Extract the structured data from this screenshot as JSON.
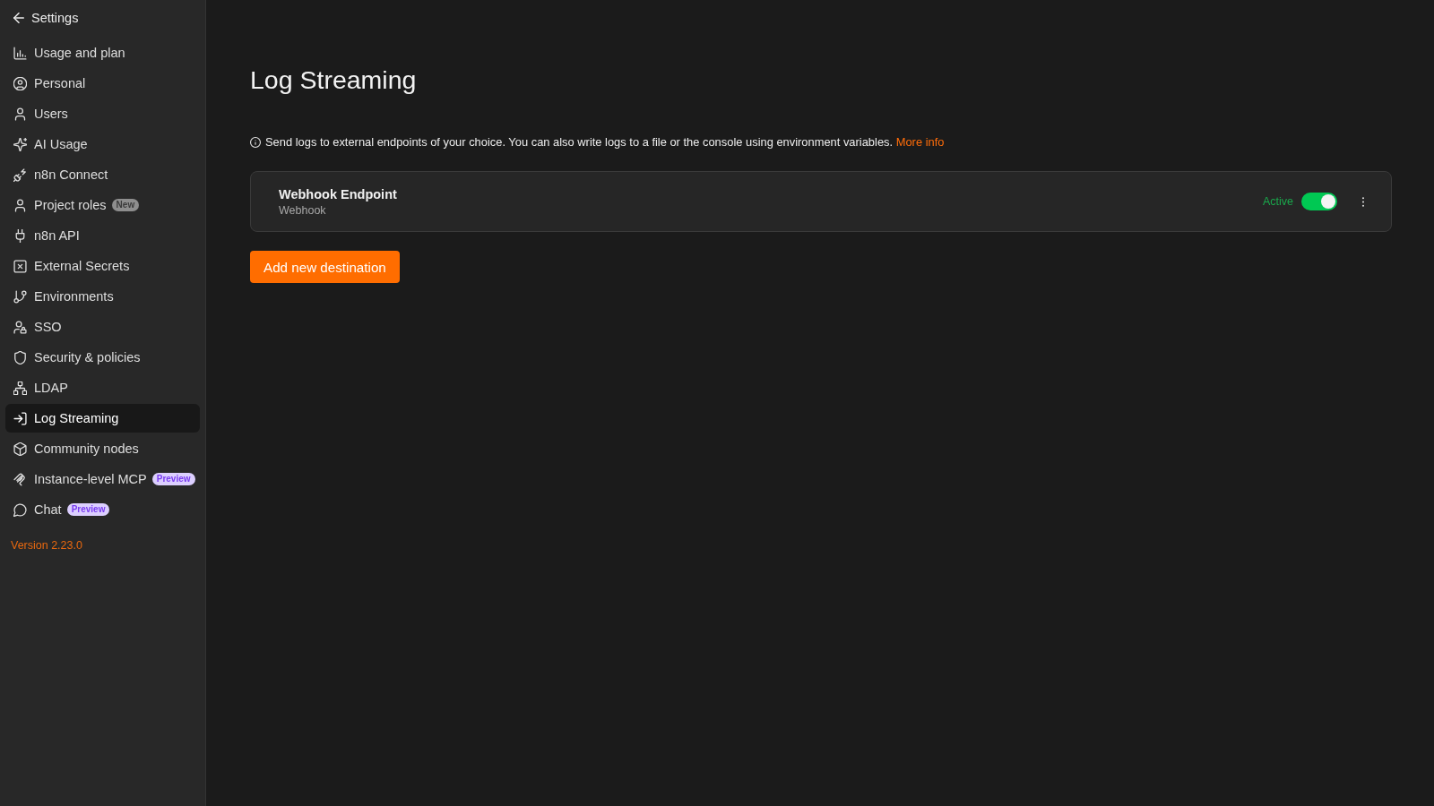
{
  "sidebar": {
    "back_label": "Settings",
    "items": [
      {
        "label": "Usage and plan",
        "selected": false
      },
      {
        "label": "Personal",
        "selected": false
      },
      {
        "label": "Users",
        "selected": false
      },
      {
        "label": "AI Usage",
        "selected": false
      },
      {
        "label": "n8n Connect",
        "selected": false
      },
      {
        "label": "Project roles",
        "selected": false,
        "badge": {
          "text": "New",
          "kind": "new"
        }
      },
      {
        "label": "n8n API",
        "selected": false
      },
      {
        "label": "External Secrets",
        "selected": false
      },
      {
        "label": "Environments",
        "selected": false
      },
      {
        "label": "SSO",
        "selected": false
      },
      {
        "label": "Security & policies",
        "selected": false
      },
      {
        "label": "LDAP",
        "selected": false
      },
      {
        "label": "Log Streaming",
        "selected": true
      },
      {
        "label": "Community nodes",
        "selected": false
      },
      {
        "label": "Instance-level MCP",
        "selected": false,
        "badge": {
          "text": "Preview",
          "kind": "preview"
        }
      },
      {
        "label": "Chat",
        "selected": false,
        "badge": {
          "text": "Preview",
          "kind": "preview"
        }
      }
    ],
    "version": "Version 2.23.0"
  },
  "page": {
    "title": "Log Streaming",
    "info": {
      "text": "Send logs to external endpoints of your choice. You can also write logs to a file or the console using environment variables.",
      "link": "More info"
    }
  },
  "destinations": [
    {
      "name": "Webhook Endpoint",
      "type": "Webhook",
      "status": "Active",
      "enabled": true
    }
  ],
  "add_button": "Add new destination"
}
